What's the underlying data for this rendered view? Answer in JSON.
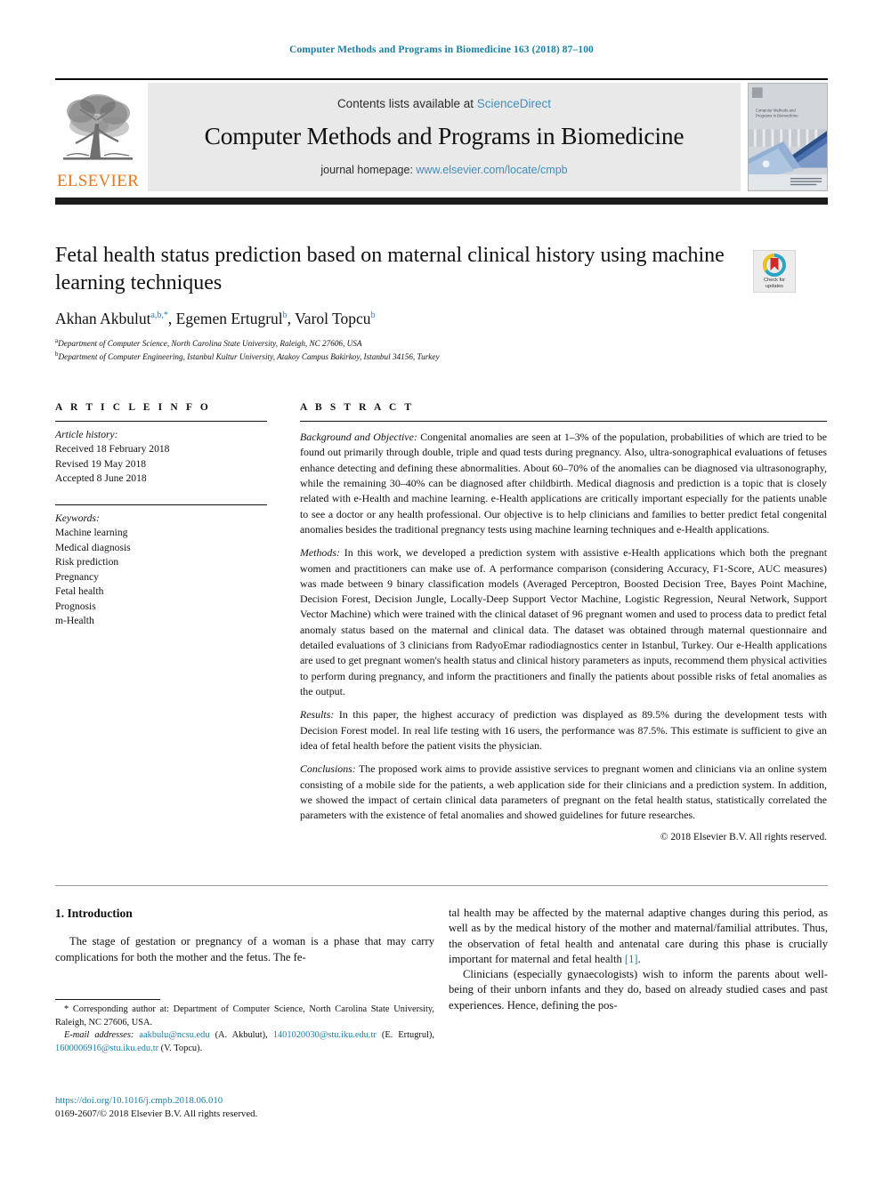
{
  "running_head": "Computer Methods and Programs in Biomedicine 163 (2018) 87–100",
  "masthead": {
    "contents_prefix": "Contents lists available at ",
    "sciencedirect": "ScienceDirect",
    "journal_title": "Computer Methods and Programs in Biomedicine",
    "homepage_prefix": "journal homepage: ",
    "homepage_url": "www.elsevier.com/locate/cmpb",
    "publisher": "ELSEVIER",
    "cover_title": "Computer Methods and Programs in Biomedicine"
  },
  "article": {
    "title": "Fetal health status prediction based on maternal clinical history using machine learning techniques",
    "crossmark_line1": "Check for",
    "crossmark_line2": "updates",
    "authors_html": "Akhan Akbulut<sup>a,b,</sup><sup>*</sup>, Egemen Ertugrul<sup>b</sup>, Varol Topcu<sup>b</sup>",
    "affiliation_a": "Department of Computer Science, North Carolina State University, Raleigh, NC 27606, USA",
    "affiliation_b": "Department of Computer Engineering, Istanbul Kultur University, Atakoy Campus Bakirkoy, Istanbul 34156, Turkey"
  },
  "article_info": {
    "heading": "A R T I C L E   I N F O",
    "history_label": "Article history:",
    "history": [
      "Received 18 February 2018",
      "Revised 19 May 2018",
      "Accepted 8 June 2018"
    ],
    "keywords_label": "Keywords:",
    "keywords": [
      "Machine learning",
      "Medical diagnosis",
      "Risk prediction",
      "Pregnancy",
      "Fetal health",
      "Prognosis",
      "m-Health"
    ]
  },
  "abstract": {
    "heading": "A B S T R A C T",
    "background_label": "Background and Objective:",
    "background_text": " Congenital anomalies are seen at 1–3% of the population, probabilities of which are tried to be found out primarily through double, triple and quad tests during pregnancy. Also, ultra-sonographical evaluations of fetuses enhance detecting and defining these abnormalities. About 60–70% of the anomalies can be diagnosed via ultrasonography, while the remaining 30–40% can be diagnosed after childbirth. Medical diagnosis and prediction is a topic that is closely related with e-Health and machine learning. e-Health applications are critically important especially for the patients unable to see a doctor or any health professional. Our objective is to help clinicians and families to better predict fetal congenital anomalies besides the traditional pregnancy tests using machine learning techniques and e-Health applications.",
    "methods_label": "Methods:",
    "methods_text": " In this work, we developed a prediction system with assistive e-Health applications which both the pregnant women and practitioners can make use of. A performance comparison (considering Accuracy, F1-Score, AUC measures) was made between 9 binary classification models (Averaged Perceptron, Boosted Decision Tree, Bayes Point Machine, Decision Forest, Decision Jungle, Locally-Deep Support Vector Machine, Logistic Regression, Neural Network, Support Vector Machine) which were trained with the clinical dataset of 96 pregnant women and used to process data to predict fetal anomaly status based on the maternal and clinical data. The dataset was obtained through maternal questionnaire and detailed evaluations of 3 clinicians from RadyoEmar radiodiagnostics center in Istanbul, Turkey. Our e-Health applications are used to get pregnant women's health status and clinical history parameters as inputs, recommend them physical activities to perform during pregnancy, and inform the practitioners and finally the patients about possible risks of fetal anomalies as the output.",
    "results_label": "Results:",
    "results_text": " In this paper, the highest accuracy of prediction was displayed as 89.5% during the development tests with Decision Forest model. In real life testing with 16 users, the performance was 87.5%. This estimate is sufficient to give an idea of fetal health before the patient visits the physician.",
    "conclusions_label": "Conclusions:",
    "conclusions_text": " The proposed work aims to provide assistive services to pregnant women and clinicians via an online system consisting of a mobile side for the patients, a web application side for their clinicians and a prediction system. In addition, we showed the impact of certain clinical data parameters of pregnant on the fetal health status, statistically correlated the parameters with the existence of fetal anomalies and showed guidelines for future researches.",
    "copyright": "© 2018 Elsevier B.V. All rights reserved."
  },
  "introduction": {
    "heading": "1. Introduction",
    "para1_left": "The stage of gestation or pregnancy of a woman is a phase that may carry complications for both the mother and the fetus. The fe-",
    "para1_right_pre": "tal health may be affected by the maternal adaptive changes during this period, as well as by the medical history of the mother and maternal/familial attributes. Thus, the observation of fetal health and antenatal care during this phase is crucially important for maternal and fetal health ",
    "ref1": "[1]",
    "para1_right_post": ".",
    "para2_right": "Clinicians (especially gynaecologists) wish to inform the parents about well-being of their unborn infants and they do, based on already studied cases and past experiences. Hence, defining the pos-"
  },
  "footnotes": {
    "corresponding": "Corresponding author at: Department of Computer Science, North Carolina State University, Raleigh, NC 27606, USA.",
    "email_label": "E-mail addresses:",
    "email1": "aakbulu@ncsu.edu",
    "email1_name": " (A. Akbulut), ",
    "email2": "1401020030@stu.iku.edu.tr",
    "email2_name": " (E. Ertugrul), ",
    "email3": "1600006916@stu.iku.edu.tr",
    "email3_name": " (V. Topcu).",
    "doi": "https://doi.org/10.1016/j.cmpb.2018.06.010",
    "issn_line": "0169-2607/© 2018 Elsevier B.V. All rights reserved."
  },
  "colors": {
    "link": "#1a7fa5",
    "elsevier_orange": "#E87722",
    "sciencedirect_blue": "#3f8fbf",
    "superscript_blue": "#2b7bb9"
  }
}
